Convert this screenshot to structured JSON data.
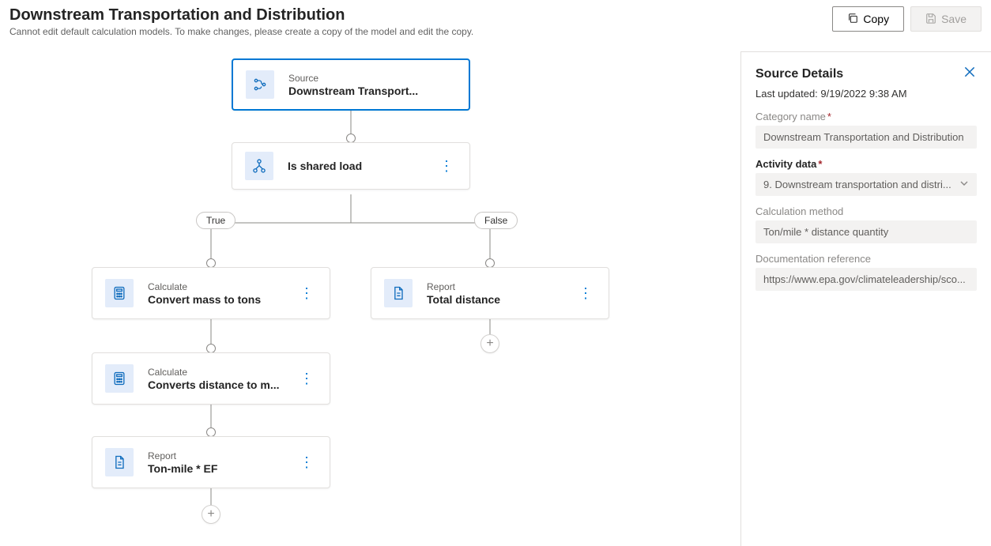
{
  "header": {
    "title": "Downstream Transportation and Distribution",
    "subtitle": "Cannot edit default calculation models. To make changes, please create a copy of the model and edit the copy.",
    "copy_label": "Copy",
    "save_label": "Save"
  },
  "flow": {
    "source": {
      "kind": "Source",
      "title": "Downstream Transport..."
    },
    "condition": {
      "title": "Is shared load"
    },
    "true_label": "True",
    "false_label": "False",
    "left1": {
      "kind": "Calculate",
      "title": "Convert mass to tons"
    },
    "left2": {
      "kind": "Calculate",
      "title": "Converts distance to m..."
    },
    "left3": {
      "kind": "Report",
      "title": "Ton-mile * EF"
    },
    "right1": {
      "kind": "Report",
      "title": "Total distance"
    }
  },
  "panel": {
    "title": "Source Details",
    "updated": "Last updated: 9/19/2022 9:38 AM",
    "category_label": "Category name",
    "category_value": "Downstream Transportation and Distribution",
    "activity_label": "Activity data",
    "activity_value": "9. Downstream transportation and distri...",
    "method_label": "Calculation method",
    "method_value": "Ton/mile * distance quantity",
    "doc_label": "Documentation reference",
    "doc_value": "https://www.epa.gov/climateleadership/sco..."
  }
}
